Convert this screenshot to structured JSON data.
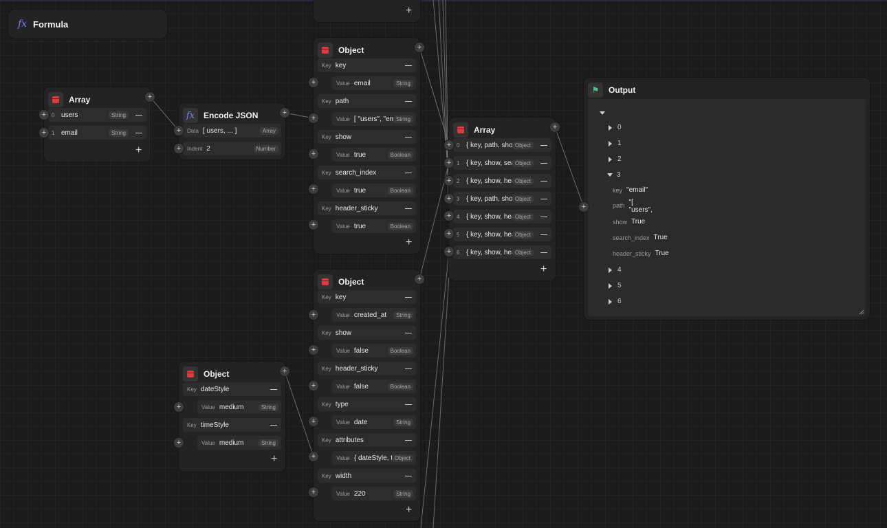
{
  "formula": {
    "title": "Formula"
  },
  "labels": {
    "key": "Key",
    "value": "Value",
    "data": "Data",
    "indent": "Indent"
  },
  "array_left": {
    "title": "Array",
    "items": [
      {
        "index": "0",
        "value": "users",
        "type": "String"
      },
      {
        "index": "1",
        "value": "email",
        "type": "String"
      }
    ]
  },
  "encode_json": {
    "title": "Encode JSON",
    "data_value": "[ users, ... ]",
    "data_type": "Array",
    "indent_value": "2",
    "indent_type": "Number"
  },
  "object_top": {
    "title": "Object",
    "pairs": [
      {
        "key": "key",
        "value": "email",
        "type": "String"
      },
      {
        "key": "path",
        "value": "[  \"users\", \"ema",
        "type": "String"
      },
      {
        "key": "show",
        "value": "true",
        "type": "Boolean"
      },
      {
        "key": "search_index",
        "value": "true",
        "type": "Boolean"
      },
      {
        "key": "header_sticky",
        "value": "true",
        "type": "Boolean"
      }
    ]
  },
  "object_mid": {
    "title": "Object",
    "pairs": [
      {
        "key": "key",
        "value": "created_at",
        "type": "String"
      },
      {
        "key": "show",
        "value": "false",
        "type": "Boolean"
      },
      {
        "key": "header_sticky",
        "value": "false",
        "type": "Boolean"
      },
      {
        "key": "type",
        "value": "date",
        "type": "String"
      },
      {
        "key": "attributes",
        "value": "{ dateStyle, tim",
        "type": "Object"
      },
      {
        "key": "width",
        "value": "220",
        "type": "String"
      }
    ]
  },
  "object_small": {
    "title": "Object",
    "pairs": [
      {
        "key": "dateStyle",
        "value": "medium",
        "type": "String"
      },
      {
        "key": "timeStyle",
        "value": "medium",
        "type": "String"
      }
    ]
  },
  "array_mid": {
    "title": "Array",
    "items": [
      {
        "index": "0",
        "value": "{ key, path, show, .",
        "type": "Object"
      },
      {
        "index": "1",
        "value": "{ key, show, search",
        "type": "Object"
      },
      {
        "index": "2",
        "value": "{ key, show, heade",
        "type": "Object"
      },
      {
        "index": "3",
        "value": "{ key, path, show, .",
        "type": "Object"
      },
      {
        "index": "4",
        "value": "{ key, show, heade",
        "type": "Object"
      },
      {
        "index": "5",
        "value": "{ key, show, heade",
        "type": "Object"
      },
      {
        "index": "6",
        "value": "{ key, show, heade",
        "type": "Object"
      }
    ]
  },
  "output": {
    "title": "Output",
    "tree": [
      {
        "label": "0",
        "expanded": false
      },
      {
        "label": "1",
        "expanded": false
      },
      {
        "label": "2",
        "expanded": false
      },
      {
        "label": "3",
        "expanded": true
      },
      {
        "label": "4",
        "expanded": false
      },
      {
        "label": "5",
        "expanded": false
      },
      {
        "label": "6",
        "expanded": false
      }
    ],
    "expanded_fields": [
      {
        "key": "key",
        "value": "\"email\""
      },
      {
        "key": "path",
        "value": "\"[",
        "value2": "\"users\","
      },
      {
        "key": "show",
        "value": "True"
      },
      {
        "key": "search_index",
        "value": "True"
      },
      {
        "key": "header_sticky",
        "value": "True"
      }
    ]
  },
  "icons": {
    "add": "plus-icon",
    "remove": "minus-icon",
    "array": "cube-icon",
    "formula": "fx-icon",
    "output": "flag-icon"
  },
  "colors": {
    "canvas": "#1b1b1b",
    "node": "#232323",
    "row": "#2d2d2d",
    "array_icon": "#e0393e",
    "formula_icon": "#7b7ff0",
    "output_icon": "#44c28c"
  }
}
